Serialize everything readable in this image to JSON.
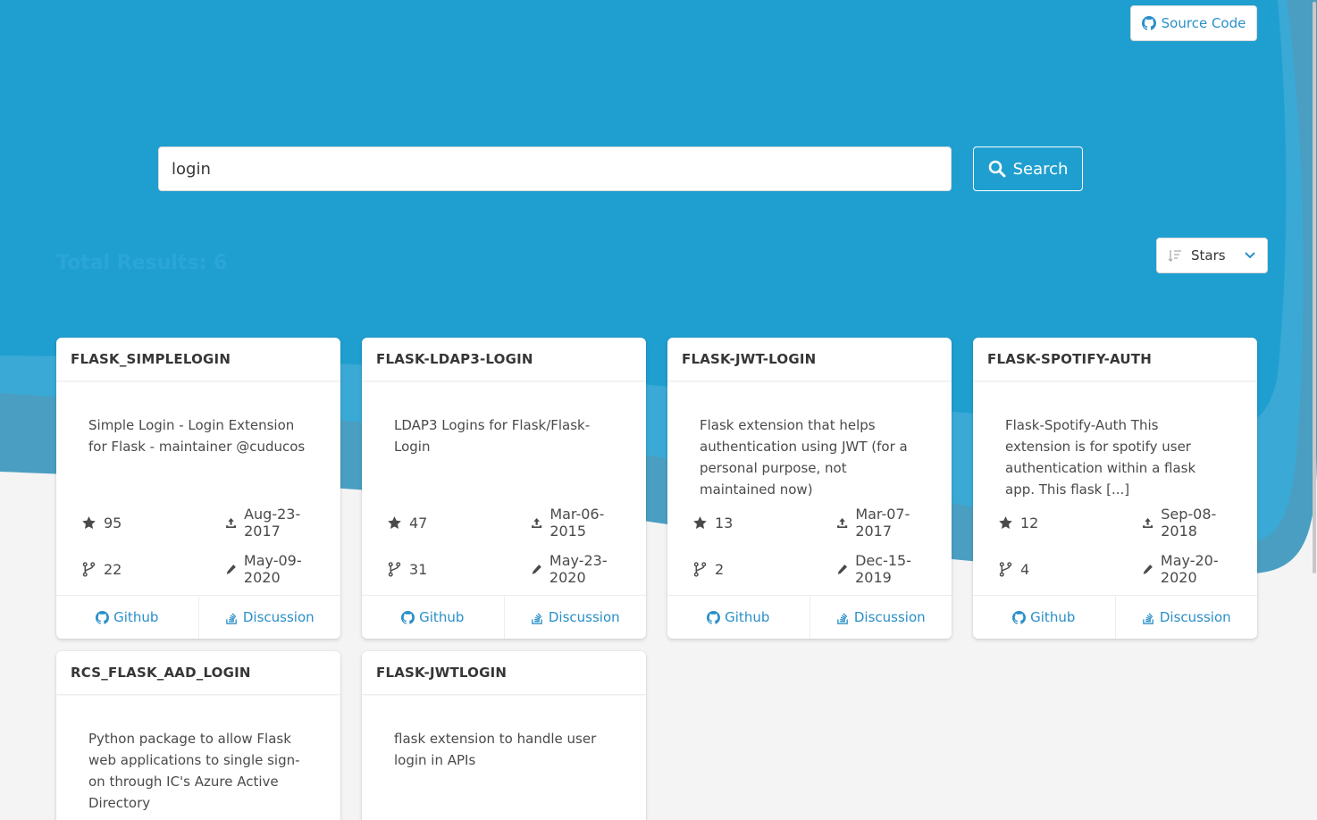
{
  "header": {
    "source_label": "Source Code"
  },
  "search": {
    "value": "login",
    "button_label": "Search"
  },
  "results": {
    "total_label": "Total Results: 6"
  },
  "sort": {
    "selected": "Stars"
  },
  "card_labels": {
    "github": "Github",
    "discussion": "Discussion"
  },
  "cards": [
    {
      "title": "FLASK_SIMPLELOGIN",
      "description": "Simple Login - Login Extension for Flask - maintainer @cuducos",
      "stars": "95",
      "forks": "22",
      "created": "Aug-23-2017",
      "updated": "May-09-2020"
    },
    {
      "title": "FLASK-LDAP3-LOGIN",
      "description": "LDAP3 Logins for Flask/Flask-Login",
      "stars": "47",
      "forks": "31",
      "created": "Mar-06-2015",
      "updated": "May-23-2020"
    },
    {
      "title": "FLASK-JWT-LOGIN",
      "description": "Flask extension that helps authentication using JWT (for a personal purpose, not maintained now)",
      "stars": "13",
      "forks": "2",
      "created": "Mar-07-2017",
      "updated": "Dec-15-2019"
    },
    {
      "title": "FLASK-SPOTIFY-AUTH",
      "description": "Flask-Spotify-Auth This extension is for spotify user authentication within a flask app. This flask [...]",
      "stars": "12",
      "forks": "4",
      "created": "Sep-08-2018",
      "updated": "May-20-2020"
    },
    {
      "title": "RCS_FLASK_AAD_LOGIN",
      "description": "Python package to allow Flask web applications to single sign-on through IC's Azure Active Directory"
    },
    {
      "title": "FLASK-JWTLOGIN",
      "description": "flask extension to handle user login in APIs"
    }
  ],
  "colors": {
    "primary": "#1f9fd0",
    "wave_light": "#3aa9d6",
    "wave_dark": "#4a9ec2",
    "link": "#2a8fc8",
    "background": "#f4f4f4"
  },
  "icons": {
    "star": "star-icon",
    "fork": "fork-icon",
    "created": "upload-icon",
    "updated": "pencil-icon",
    "github": "github-icon",
    "discussion": "stack-overflow-icon",
    "search": "search-icon",
    "sort": "sort-icon",
    "chevron": "chevron-down-icon"
  }
}
